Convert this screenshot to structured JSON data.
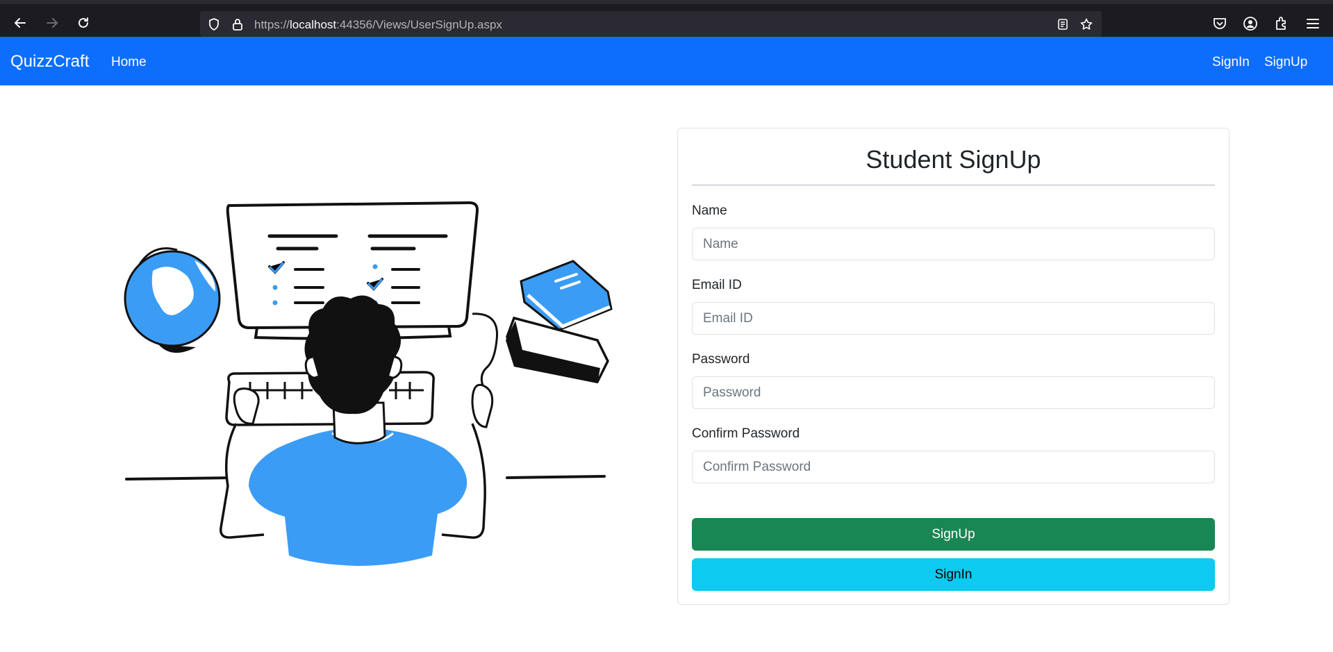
{
  "browser": {
    "url_prefix": "https://",
    "url_host": "localhost",
    "url_rest": ":44356/Views/UserSignUp.aspx"
  },
  "navbar": {
    "brand": "QuizzCraft",
    "home": "Home",
    "signin": "SignIn",
    "signup": "SignUp",
    "color": "#0d6efd"
  },
  "form": {
    "title": "Student SignUp",
    "name_label": "Name",
    "name_placeholder": "Name",
    "email_label": "Email ID",
    "email_placeholder": "Email ID",
    "password_label": "Password",
    "password_placeholder": "Password",
    "confirm_label": "Confirm Password",
    "confirm_placeholder": "Confirm Password",
    "signup_button": "SignUp",
    "signin_button": "SignIn"
  },
  "colors": {
    "signup_button": "#198754",
    "signin_button": "#0dcaf0",
    "illustration_accent": "#3b9cf5"
  }
}
